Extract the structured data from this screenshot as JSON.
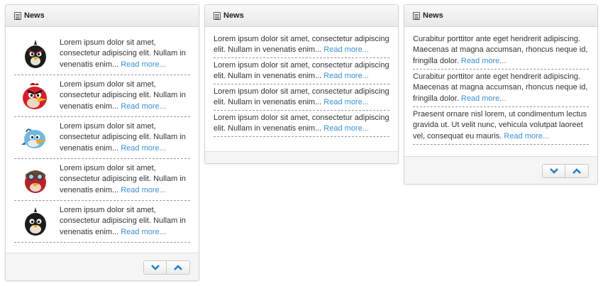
{
  "widgets": [
    {
      "title": "News",
      "items": [
        {
          "text": "Lorem ipsum dolor sit amet, consectetur adipiscing elit. Nullam in venenatis enim... ",
          "link": "Read more...",
          "avatar": "black-bird-icon"
        },
        {
          "text": "Lorem ipsum dolor sit amet, consectetur adipiscing elit. Nullam in venenatis enim... ",
          "link": "Read more...",
          "avatar": "red-bird-icon"
        },
        {
          "text": "Lorem ipsum dolor sit amet, consectetur adipiscing elit. Nullam in venenatis enim... ",
          "link": "Read more...",
          "avatar": "blue-bird-icon"
        },
        {
          "text": "Lorem ipsum dolor sit amet, consectetur adipiscing elit. Nullam in venenatis enim... ",
          "link": "Read more...",
          "avatar": "goggles-bird-icon"
        },
        {
          "text": "Lorem ipsum dolor sit amet, consectetur adipiscing elit. Nullam in venenatis enim... ",
          "link": "Read more...",
          "avatar": "black-bomb-bird-icon"
        }
      ]
    },
    {
      "title": "News",
      "items": [
        {
          "text": "Lorem ipsum dolor sit amet, consectetur adipiscing elit. Nullam in venenatis enim... ",
          "link": "Read more..."
        },
        {
          "text": "Lorem ipsum dolor sit amet, consectetur adipiscing elit. Nullam in venenatis enim... ",
          "link": "Read more..."
        },
        {
          "text": "Lorem ipsum dolor sit amet, consectetur adipiscing elit. Nullam in venenatis enim... ",
          "link": "Read more..."
        },
        {
          "text": "Lorem ipsum dolor sit amet, consectetur adipiscing elit. Nullam in venenatis enim... ",
          "link": "Read more..."
        }
      ]
    },
    {
      "title": "News",
      "items": [
        {
          "text": "Curabitur porttitor ante eget hendrerit adipiscing. Maecenas at magna accumsan, rhoncus neque id, fringilla dolor. ",
          "link": "Read more..."
        },
        {
          "text": "Curabitur porttitor ante eget hendrerit adipiscing. Maecenas at magna accumsan, rhoncus neque id, fringilla dolor. ",
          "link": "Read more..."
        },
        {
          "text": "Praesent ornare nisl lorem, ut condimentum lectus gravida ut. Ut velit nunc, vehicula volutpat laoreet vel, consequat eu mauris. ",
          "link": "Read more..."
        }
      ]
    }
  ],
  "controls": {
    "down_icon": "chevron-down-icon",
    "up_icon": "chevron-up-icon"
  },
  "colors": {
    "link": "#3a8fd1",
    "chevron": "#2a7fc4"
  }
}
